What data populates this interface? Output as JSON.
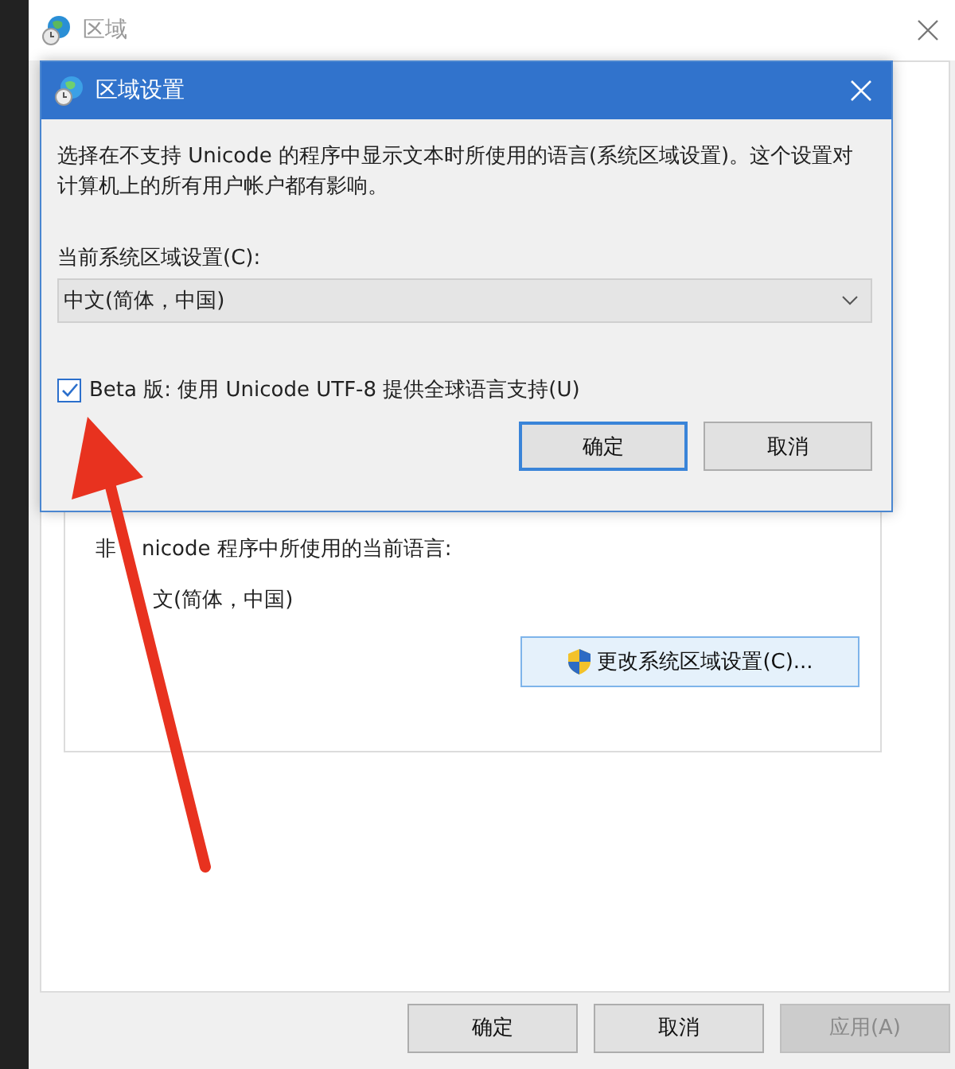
{
  "window": {
    "title": "区域"
  },
  "panel": {
    "current_language_label": [
      "非",
      "nicode 程序中所使用的当前语言:"
    ],
    "current_language": "文(简体，中国)",
    "change_button": "更改系统区域设置(C)..."
  },
  "footer_buttons": [
    {
      "label": "确定",
      "disabled": false
    },
    {
      "label": "取消",
      "disabled": false
    },
    {
      "label": "应用(A)",
      "disabled": true
    }
  ],
  "dialog": {
    "title": "区域设置",
    "description": "选择在不支持 Unicode 的程序中显示文本时所使用的语言(系统区域设置)。这个设置对计算机上的所有用户帐户都有影响。",
    "locale_label": "当前系统区域设置(C):",
    "locale_value": "中文(简体，中国)",
    "beta_checkbox": {
      "label": "Beta 版: 使用 Unicode UTF-8 提供全球语言支持(U)",
      "checked": true
    },
    "buttons": [
      {
        "label": "确定",
        "default": true
      },
      {
        "label": "取消",
        "default": false
      }
    ]
  }
}
